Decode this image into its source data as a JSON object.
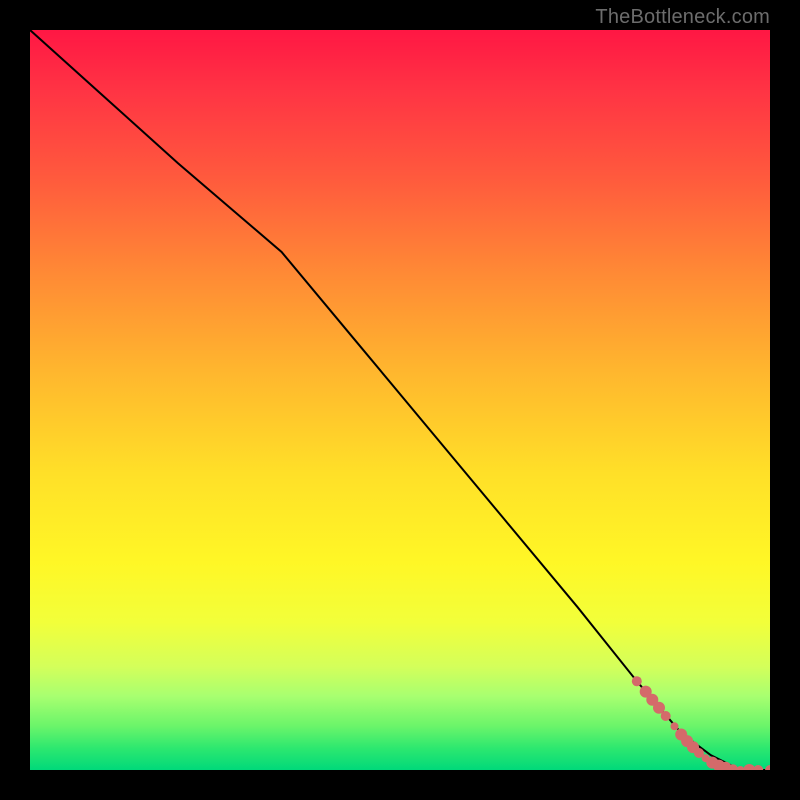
{
  "watermark": "TheBottleneck.com",
  "chart_data": {
    "type": "line",
    "title": "",
    "xlabel": "",
    "ylabel": "",
    "xlim": [
      0,
      100
    ],
    "ylim": [
      0,
      100
    ],
    "grid": false,
    "legend": false,
    "series": [
      {
        "name": "curve",
        "x": [
          0,
          10,
          20,
          27,
          34,
          44,
          54,
          64,
          74,
          82,
          88,
          92,
          96,
          100
        ],
        "y": [
          100,
          91,
          82,
          76,
          70,
          58,
          46,
          34,
          22,
          12,
          5,
          2,
          0,
          0
        ]
      }
    ],
    "scatter": {
      "name": "points",
      "color": "#d46a6a",
      "points": [
        {
          "x": 82.0,
          "y": 12.0,
          "r": 5
        },
        {
          "x": 83.2,
          "y": 10.6,
          "r": 6
        },
        {
          "x": 84.1,
          "y": 9.5,
          "r": 6
        },
        {
          "x": 85.0,
          "y": 8.4,
          "r": 6
        },
        {
          "x": 85.9,
          "y": 7.3,
          "r": 5
        },
        {
          "x": 87.1,
          "y": 5.9,
          "r": 4
        },
        {
          "x": 88.0,
          "y": 4.8,
          "r": 6
        },
        {
          "x": 88.8,
          "y": 3.9,
          "r": 6
        },
        {
          "x": 89.6,
          "y": 3.1,
          "r": 6
        },
        {
          "x": 90.4,
          "y": 2.3,
          "r": 5
        },
        {
          "x": 91.3,
          "y": 1.6,
          "r": 4
        },
        {
          "x": 92.2,
          "y": 1.0,
          "r": 6
        },
        {
          "x": 93.1,
          "y": 0.6,
          "r": 6
        },
        {
          "x": 94.0,
          "y": 0.3,
          "r": 6
        },
        {
          "x": 95.0,
          "y": 0.1,
          "r": 5
        },
        {
          "x": 96.0,
          "y": 0.0,
          "r": 4
        },
        {
          "x": 97.2,
          "y": 0.0,
          "r": 6
        },
        {
          "x": 98.4,
          "y": 0.0,
          "r": 5
        },
        {
          "x": 100.0,
          "y": 0.0,
          "r": 5
        }
      ]
    }
  }
}
